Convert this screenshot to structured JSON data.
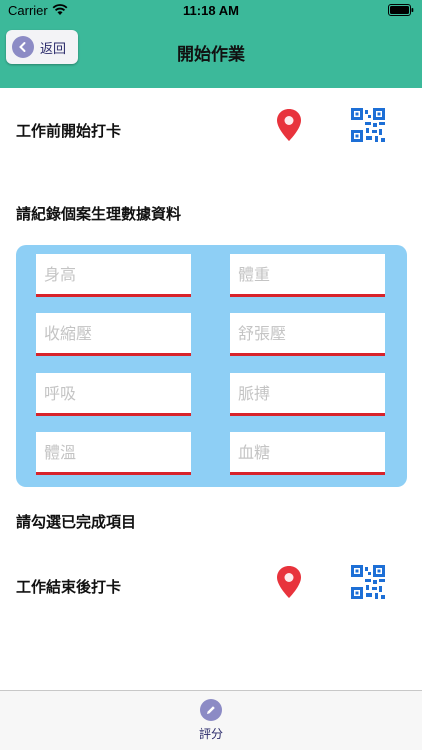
{
  "status_bar": {
    "carrier": "Carrier",
    "time": "11:18 AM"
  },
  "nav": {
    "back_label": "返回",
    "title": "開始作業"
  },
  "check_in": {
    "label": "工作前開始打卡",
    "location_icon": "location-pin-icon",
    "qr_icon": "qr-code-icon"
  },
  "vitals": {
    "section_title": "請紀錄個案生理數據資料",
    "fields": [
      {
        "placeholder": "身高"
      },
      {
        "placeholder": "體重"
      },
      {
        "placeholder": "收縮壓"
      },
      {
        "placeholder": "舒張壓"
      },
      {
        "placeholder": "呼吸"
      },
      {
        "placeholder": "脈搏"
      },
      {
        "placeholder": "體溫"
      },
      {
        "placeholder": "血糖"
      }
    ]
  },
  "completed_items": {
    "section_title": "請勾選已完成項目"
  },
  "check_out": {
    "label": "工作結束後打卡",
    "location_icon": "location-pin-icon",
    "qr_icon": "qr-code-icon"
  },
  "tab_bar": {
    "items": [
      {
        "label": "評分",
        "icon": "pencil-icon"
      }
    ]
  },
  "colors": {
    "header": "#3cb99a",
    "panel": "#8ecff5",
    "underline": "#d8232a",
    "pin": "#e8333c",
    "qr": "#1d6fd6",
    "accent": "#8c8bc5"
  }
}
